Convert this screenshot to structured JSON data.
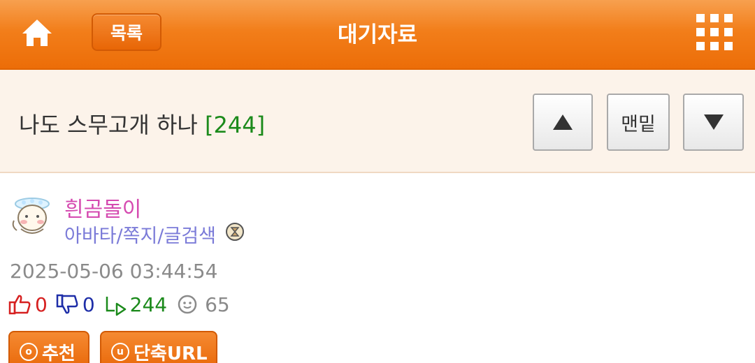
{
  "header": {
    "home_icon": "home-icon",
    "list_label": "목록",
    "title": "대기자료",
    "menu_icon": "grid-menu-icon",
    "accent_color": "#f27e1a"
  },
  "post": {
    "title": "나도 스무고개 하나",
    "reply_count_label": "[244]",
    "nav": {
      "up_icon": "▲",
      "bottom_label": "맨밑",
      "down_icon": "▼"
    }
  },
  "author": {
    "name": "흰곰돌이",
    "links": "아바타/쪽지/글검색",
    "avatar_icon": "bear-avatar-icon",
    "badge_icon": "level-badge-icon"
  },
  "meta": {
    "date": "2025-05-06 03:44:54",
    "up_votes": "0",
    "down_votes": "0",
    "replies": "244",
    "views": "65"
  },
  "actions": {
    "recommend_icon": "o",
    "recommend_label": "추천",
    "shorturl_icon": "u",
    "shorturl_label": "단축URL"
  }
}
